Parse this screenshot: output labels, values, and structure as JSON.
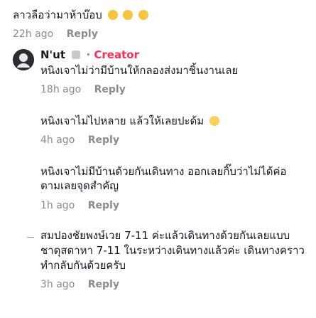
{
  "comments": [
    {
      "text": "ลาวลือว่ามาห้าบ๊อบ",
      "emojis": [
        "pleading-face",
        "pleading-face",
        "pleading-face"
      ],
      "time": "22h ago",
      "reply": "Reply"
    },
    {
      "author": "N'ut",
      "author_tag": "Creator",
      "text": "หนิงเจาไม่ว่ามีบ้านให้กลองส่งมาชิ้นงานเลย",
      "time": "18h ago",
      "reply": "Reply"
    },
    {
      "text": "หนิงเจาไม่ไปหลาย แล้วให้เลยปะด้ม",
      "emojis": [
        "smiling-face"
      ],
      "time": "4h ago",
      "reply": "Reply"
    },
    {
      "lines": [
        "หนิงเจาไม่มีบ้านด้วยกันเดินทาง ออกเลยกิ๊บว่าไม่ได้ค่อ",
        "ตามเลยจุดสำคัญ"
      ],
      "time": "1h ago",
      "reply": "Reply"
    },
    {
      "lines": [
        "สมปองชัยพงษ์เวย 7-11 ค่ะแล้วเดินทางด้วยกันเลยแบบ",
        "ชาดุสดาหา 7-11 ในระหว่างเดินทางแล้วค่ะ เดินทางคราว",
        "ทำกลับกันด้วยครับ"
      ],
      "time": "3h ago",
      "reply": "Reply"
    }
  ],
  "colors": {
    "creator": "#fe2c55",
    "meta": "#8a8b91",
    "text": "#161823"
  }
}
